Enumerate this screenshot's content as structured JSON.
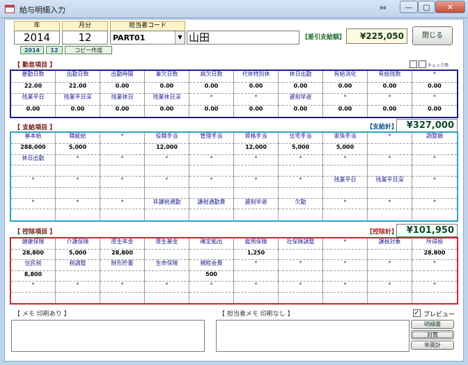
{
  "window": {
    "title": "給与明細入力",
    "nav_glyph": "⇔",
    "min": "—",
    "max": "▢",
    "close": "✕"
  },
  "header": {
    "year_label": "年",
    "month_label": "月分",
    "staff_label": "担当者コード",
    "year": "2014",
    "month": "12",
    "staff_code": "PART01",
    "staff_name": "山田",
    "mini_year": "2014",
    "mini_month": "12",
    "copy_button": "コピー作成",
    "net_label": "【差引支給額】",
    "net_value": "¥225,050",
    "close_button": "閉じる"
  },
  "attendance": {
    "title": "【 勤怠項目 】",
    "check_label": "チェック用",
    "rows": [
      [
        "要勤日数",
        "出勤日数",
        "出勤時間",
        "事欠日数",
        "病欠日数",
        "代休特別休",
        "休日出勤",
        "有給消化",
        "有給残数",
        "*"
      ],
      [
        "22.00",
        "22.00",
        "0.00",
        "0.00",
        "0.00",
        "0.00",
        "0.00",
        "0.00",
        "0.00",
        "0.00"
      ],
      [
        "残業平日",
        "残業平日深",
        "残業休日",
        "残業休日深",
        "*",
        "*",
        "遅刻早退",
        "*",
        "*",
        "*"
      ],
      [
        "0.00",
        "0.00",
        "0.00",
        "0.00",
        "0.00",
        "0.00",
        "0.00",
        "0.00",
        "0.00",
        "0.00"
      ]
    ]
  },
  "payment": {
    "title": "【 支給項目 】",
    "total_label": "【支給計】",
    "total": "¥327,000",
    "rows": [
      [
        "基本給",
        "職能給",
        "*",
        "役職手当",
        "管理手当",
        "資格手当",
        "住宅手当",
        "家族手当",
        "*",
        "調整額"
      ],
      [
        "288,000",
        "5,000",
        "",
        "12,000",
        "",
        "12,000",
        "5,000",
        "5,000",
        "",
        ""
      ],
      [
        "休日出勤",
        "*",
        "*",
        "*",
        "*",
        "*",
        "*",
        "*",
        "*",
        "*"
      ],
      [
        "",
        "",
        "",
        "",
        "",
        "",
        "",
        "",
        "",
        ""
      ],
      [
        "*",
        "*",
        "*",
        "*",
        "*",
        "*",
        "*",
        "残業平日",
        "残業平日深",
        "*"
      ],
      [
        "",
        "",
        "",
        "",
        "",
        "",
        "",
        "",
        "",
        ""
      ],
      [
        "*",
        "*",
        "*",
        "非課税通勤",
        "課税通勤費",
        "遅刻早退",
        "欠勤",
        "*",
        "*",
        "*"
      ],
      [
        "",
        "",
        "",
        "",
        "",
        "",
        "",
        "",
        "",
        ""
      ]
    ]
  },
  "deduction": {
    "title": "【 控除項目 】",
    "total_label": "【控除計】",
    "total": "¥101,950",
    "rows": [
      [
        "健康保険",
        "介護保険",
        "厚生年金",
        "厚生基金",
        "確定拠出",
        "雇用保険",
        "社保険調整",
        "*",
        "課税対象",
        "所得税"
      ],
      [
        "28,800",
        "5,000",
        "28,800",
        "",
        "",
        "1,250",
        "",
        "",
        "",
        "28,800"
      ],
      [
        "住民税",
        "税調整",
        "財形貯蓄",
        "生命保険",
        "親睦会費",
        "*",
        "*",
        "*",
        "*",
        "*"
      ],
      [
        "8,800",
        "",
        "",
        "",
        "500",
        "",
        "",
        "",
        "",
        ""
      ],
      [
        "*",
        "*",
        "*",
        "*",
        "*",
        "*",
        "*",
        "*",
        "*",
        "*"
      ],
      [
        "",
        "",
        "",
        "",
        "",
        "",
        "",
        "",
        "",
        ""
      ]
    ]
  },
  "memo": {
    "print_label": "【 メモ 印刷あり 】",
    "staff_label": "【 担当者メモ 印刷なし 】",
    "preview_label": "プレビュー",
    "preview_checked": "✓",
    "btn_statement": "明細書",
    "btn_envelope": "封筒",
    "btn_annual": "年間計"
  },
  "colors": {
    "attendance": "#1c1c8a",
    "payment": "#29a3c4",
    "deduction": "#c8242c"
  }
}
